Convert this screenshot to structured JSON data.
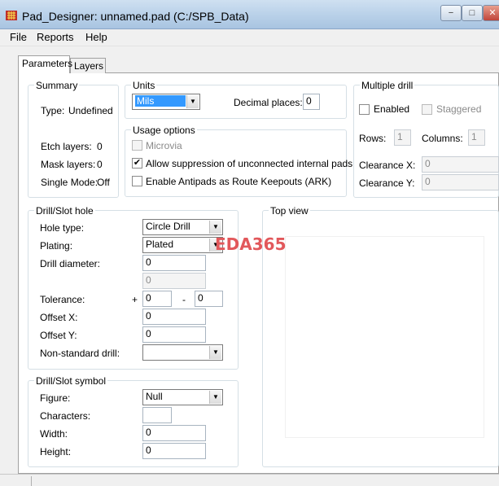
{
  "window": {
    "title": "Pad_Designer: unnamed.pad (C:/SPB_Data)",
    "controls": {
      "minimize": "−",
      "maximize": "□",
      "close": "✕"
    }
  },
  "menu": [
    "File",
    "Reports",
    "Help"
  ],
  "tabs": {
    "parameters": "Parameters",
    "layers": "Layers"
  },
  "summary": {
    "legend": "Summary",
    "type_label": "Type:",
    "type_value": "Undefined",
    "etch_label": "Etch layers:",
    "etch_value": "0",
    "mask_label": "Mask layers:",
    "mask_value": "0",
    "single_label": "Single Mode:",
    "single_value": "Off"
  },
  "units": {
    "legend": "Units",
    "selected": "Mils",
    "decimal_label": "Decimal places:",
    "decimal_value": "0"
  },
  "usage": {
    "legend": "Usage options",
    "microvia": {
      "label": "Microvia",
      "checked": false,
      "enabled": false
    },
    "suppress": {
      "label": "Allow suppression of unconnected internal pads",
      "checked": true,
      "enabled": true
    },
    "antipads": {
      "label": "Enable Antipads as Route Keepouts (ARK)",
      "checked": false,
      "enabled": true
    }
  },
  "multiple_drill": {
    "legend": "Multiple drill",
    "enabled_label": "Enabled",
    "staggered_label": "Staggered",
    "rows_label": "Rows:",
    "rows_value": "1",
    "columns_label": "Columns:",
    "columns_value": "1",
    "clearance_x_label": "Clearance X:",
    "clearance_x_value": "0",
    "clearance_y_label": "Clearance Y:",
    "clearance_y_value": "0"
  },
  "drill_hole": {
    "legend": "Drill/Slot hole",
    "hole_type_label": "Hole type:",
    "hole_type_value": "Circle Drill",
    "plating_label": "Plating:",
    "plating_value": "Plated",
    "diameter_label": "Drill diameter:",
    "diameter_value": "0",
    "diameter_secondary": "0",
    "tolerance_label": "Tolerance:",
    "tol_plus_sign": "+",
    "tol_plus_value": "0",
    "tol_minus_sign": "-",
    "tol_minus_value": "0",
    "offset_x_label": "Offset X:",
    "offset_x_value": "0",
    "offset_y_label": "Offset Y:",
    "offset_y_value": "0",
    "nonstd_label": "Non-standard drill:",
    "nonstd_value": ""
  },
  "drill_symbol": {
    "legend": "Drill/Slot symbol",
    "figure_label": "Figure:",
    "figure_value": "Null",
    "characters_label": "Characters:",
    "characters_value": "",
    "width_label": "Width:",
    "width_value": "0",
    "height_label": "Height:",
    "height_value": "0"
  },
  "top_view": {
    "legend": "Top view"
  },
  "watermark": "EDA365"
}
